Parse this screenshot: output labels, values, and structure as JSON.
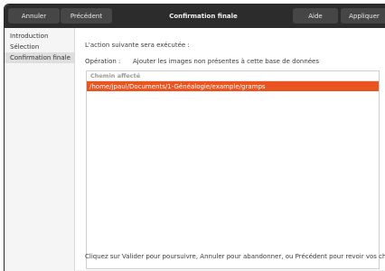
{
  "headerbar": {
    "cancel_label": "Annuler",
    "previous_label": "Précédent",
    "title": "Confirmation finale",
    "help_label": "Aide",
    "apply_label": "Appliquer"
  },
  "sidebar": {
    "items": [
      {
        "label": "Introduction"
      },
      {
        "label": "Sélection"
      },
      {
        "label": "Confirmation finale"
      }
    ],
    "active_index": 2
  },
  "main": {
    "intro_text": "L'action suivante sera exécutée :",
    "operation_label": "Opération :",
    "operation_value": "Ajouter les images non présentes à cette base de données",
    "table": {
      "column_header": "Chemin affecté",
      "rows": [
        "/home/jpaul/Documents/1-Généalogie/example/gramps"
      ]
    },
    "footer_text": "Cliquez sur Valider pour poursuivre, Annuler pour abandonner, ou Précédent pour revoir vos choix."
  },
  "colors": {
    "headerbar_bg": "#2c2c2c",
    "selection_accent": "#e95420",
    "sidebar_bg": "#f5f5f5"
  }
}
